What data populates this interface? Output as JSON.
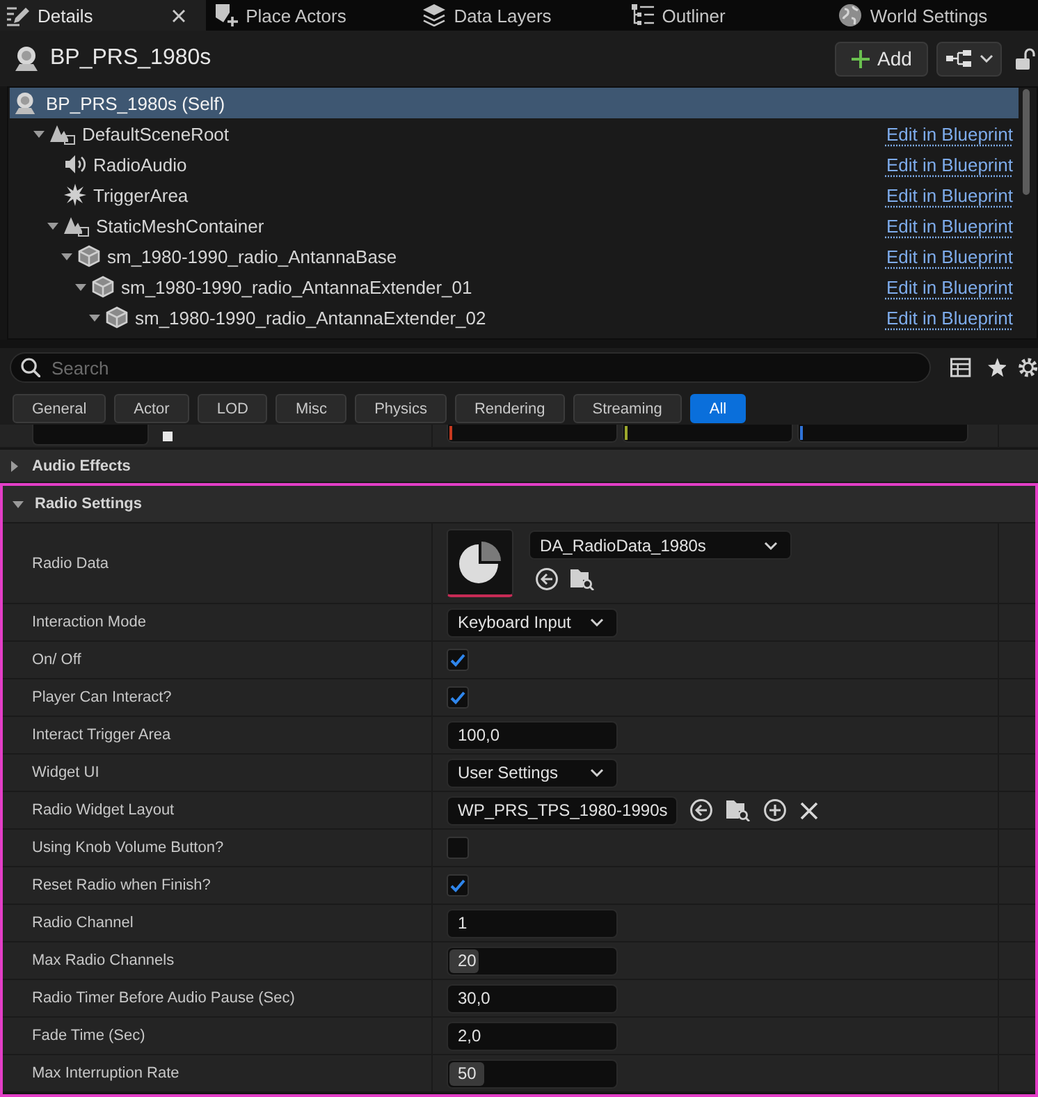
{
  "tabs": [
    {
      "label": "Details",
      "selected": true,
      "closable": true
    },
    {
      "label": "Place Actors",
      "selected": false,
      "closable": false
    },
    {
      "label": "Data Layers",
      "selected": false,
      "closable": false
    },
    {
      "label": "Outliner",
      "selected": false,
      "closable": false
    },
    {
      "label": "World Settings",
      "selected": false,
      "closable": false
    }
  ],
  "actor": {
    "name": "BP_PRS_1980s",
    "add_button": "Add",
    "locked": false
  },
  "components": {
    "self": {
      "label": "BP_PRS_1980s (Self)",
      "selected": true
    },
    "tree": [
      {
        "name": "DefaultSceneRoot",
        "kind": "scene",
        "expanded": true,
        "selected": false,
        "link": "Edit in Blueprint",
        "children": [
          {
            "name": "RadioAudio",
            "kind": "audio",
            "selected": false,
            "link": "Edit in Blueprint"
          },
          {
            "name": "TriggerArea",
            "kind": "trigger",
            "selected": false,
            "link": "Edit in Blueprint"
          },
          {
            "name": "StaticMeshContainer",
            "kind": "scene",
            "expanded": true,
            "selected": false,
            "link": "Edit in Blueprint",
            "children": [
              {
                "name": "sm_1980-1990_radio_AntannaBase",
                "kind": "mesh",
                "expanded": true,
                "selected": false,
                "link": "Edit in Blueprint",
                "children": [
                  {
                    "name": "sm_1980-1990_radio_AntannaExtender_01",
                    "kind": "mesh",
                    "expanded": true,
                    "selected": false,
                    "link": "Edit in Blueprint",
                    "children": [
                      {
                        "name": "sm_1980-1990_radio_AntannaExtender_02",
                        "kind": "mesh",
                        "expanded": true,
                        "selected": false,
                        "link": "Edit in Blueprint"
                      }
                    ]
                  }
                ]
              }
            ]
          }
        ]
      }
    ]
  },
  "search": {
    "placeholder": "Search"
  },
  "filters": [
    {
      "label": "General",
      "selected": false
    },
    {
      "label": "Actor",
      "selected": false
    },
    {
      "label": "LOD",
      "selected": false
    },
    {
      "label": "Misc",
      "selected": false
    },
    {
      "label": "Physics",
      "selected": false
    },
    {
      "label": "Rendering",
      "selected": false
    },
    {
      "label": "Streaming",
      "selected": false
    },
    {
      "label": "All",
      "selected": true
    }
  ],
  "partial_row": {
    "axes": [
      {
        "color": "#c8391f"
      },
      {
        "color": "#9ca82c"
      },
      {
        "color": "#2f73d8"
      }
    ]
  },
  "sections": [
    {
      "title": "Audio Effects",
      "expanded": false,
      "highlighted": false
    },
    {
      "title": "Radio Settings",
      "expanded": true,
      "highlighted": true,
      "properties": [
        {
          "label": "Radio Data",
          "kind": "asset",
          "value": "DA_RadioData_1980s"
        },
        {
          "label": "Interaction Mode",
          "kind": "dropdown",
          "value": "Keyboard Input"
        },
        {
          "label": "On/ Off",
          "kind": "checkbox",
          "checked": true
        },
        {
          "label": "Player Can Interact?",
          "kind": "checkbox",
          "checked": true
        },
        {
          "label": "Interact Trigger Area",
          "kind": "number",
          "value": "100,0"
        },
        {
          "label": "Widget UI",
          "kind": "dropdown",
          "value": "User Settings"
        },
        {
          "label": "Radio Widget Layout",
          "kind": "class",
          "value": "WP_PRS_TPS_1980-1990s"
        },
        {
          "label": "Using Knob Volume Button?",
          "kind": "checkbox",
          "checked": false
        },
        {
          "label": "Reset Radio when Finish?",
          "kind": "checkbox",
          "checked": true
        },
        {
          "label": "Radio Channel",
          "kind": "number",
          "value": "1"
        },
        {
          "label": "Max Radio Channels",
          "kind": "slider",
          "value": "20",
          "level": 0.17
        },
        {
          "label": "Radio Timer Before Audio Pause (Sec)",
          "kind": "number",
          "value": "30,0"
        },
        {
          "label": "Fade Time (Sec)",
          "kind": "number",
          "value": "2,0"
        },
        {
          "label": "Max Interruption Rate",
          "kind": "slider",
          "value": "50",
          "level": 0.21
        }
      ]
    }
  ]
}
